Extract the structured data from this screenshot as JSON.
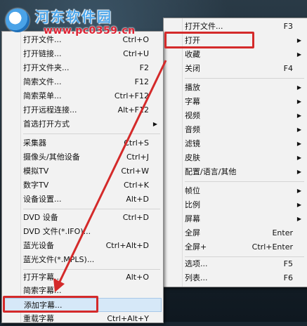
{
  "watermark": {
    "brand": "河东软件园",
    "url": "www.pc0359.cn"
  },
  "left_menu": {
    "items": [
      {
        "label": "打开文件...",
        "shortcut": "Ctrl+O"
      },
      {
        "label": "打开链接...",
        "shortcut": "Ctrl+U"
      },
      {
        "label": "打开文件夹...",
        "shortcut": "F2"
      },
      {
        "label": "简索文件...",
        "shortcut": "F12"
      },
      {
        "label": "简索菜单...",
        "shortcut": "Ctrl+F12"
      },
      {
        "label": "打开远程连接...",
        "shortcut": "Alt+F12"
      },
      {
        "label": "首选打开方式",
        "shortcut": ""
      },
      {
        "label": "采集器",
        "shortcut": "Ctrl+S"
      },
      {
        "label": "摄像头/其他设备",
        "shortcut": "Ctrl+J"
      },
      {
        "label": "模拟TV",
        "shortcut": "Ctrl+W"
      },
      {
        "label": "数字TV",
        "shortcut": "Ctrl+K"
      },
      {
        "label": "设备设置...",
        "shortcut": "Alt+D"
      },
      {
        "label": "DVD 设备",
        "shortcut": "Ctrl+D"
      },
      {
        "label": "DVD 文件(*.IFO)...",
        "shortcut": ""
      },
      {
        "label": "蓝光设备",
        "shortcut": "Ctrl+Alt+D"
      },
      {
        "label": "蓝光文件(*.MPLS)...",
        "shortcut": ""
      },
      {
        "label": "打开字幕...",
        "shortcut": "Alt+O"
      },
      {
        "label": "简索字幕...",
        "shortcut": ""
      },
      {
        "label": "添加字幕...",
        "shortcut": ""
      },
      {
        "label": "重载字幕",
        "shortcut": "Ctrl+Alt+Y"
      }
    ]
  },
  "right_menu": {
    "items": [
      {
        "label": "打开文件...",
        "shortcut": "F3"
      },
      {
        "label": "打开",
        "shortcut": ""
      },
      {
        "label": "收藏",
        "shortcut": ""
      },
      {
        "label": "关闭",
        "shortcut": "F4"
      },
      {
        "label": "播放",
        "shortcut": ""
      },
      {
        "label": "字幕",
        "shortcut": ""
      },
      {
        "label": "视频",
        "shortcut": ""
      },
      {
        "label": "音频",
        "shortcut": ""
      },
      {
        "label": "滤镜",
        "shortcut": ""
      },
      {
        "label": "皮肤",
        "shortcut": ""
      },
      {
        "label": "配置/语言/其他",
        "shortcut": ""
      },
      {
        "label": "帧位",
        "shortcut": ""
      },
      {
        "label": "比例",
        "shortcut": ""
      },
      {
        "label": "屏幕",
        "shortcut": ""
      },
      {
        "label": "全屏",
        "shortcut": "Enter"
      },
      {
        "label": "全屏+",
        "shortcut": "Ctrl+Enter"
      },
      {
        "label": "选项...",
        "shortcut": "F5"
      },
      {
        "label": "列表...",
        "shortcut": "F6"
      }
    ]
  },
  "submenu_arrow": "▶",
  "colors": {
    "annotation_red": "#d42a2a",
    "menu_bg": "#f2f2f2",
    "highlight": "#d6e8f8"
  }
}
